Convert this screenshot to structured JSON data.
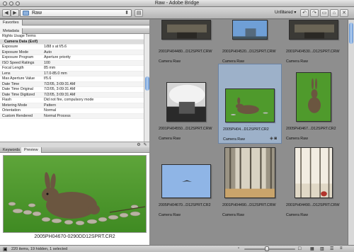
{
  "window": {
    "title": "Raw - Adobe Bridge"
  },
  "toolbar": {
    "back_glyph": "◀",
    "forward_glyph": "▶",
    "path": "Raw",
    "sort": "Unfiltered ▾"
  },
  "left_tabs": {
    "favorites": "Favorites"
  },
  "metadata": {
    "tab": "Metadata",
    "rows": [
      {
        "key": "Rights Usage Terms",
        "value": ""
      },
      {
        "key": "Camera Data (Exif)",
        "value": "",
        "section": true
      },
      {
        "key": "Exposure",
        "value": "1/88 s at f/5.6"
      },
      {
        "key": "Exposure Mode",
        "value": "Auto"
      },
      {
        "key": "Exposure Program",
        "value": "Aperture priority"
      },
      {
        "key": "ISO Speed Ratings",
        "value": "100"
      },
      {
        "key": "Focal Length",
        "value": "85 mm"
      },
      {
        "key": "Lens",
        "value": "17.0-85.0 mm"
      },
      {
        "key": "Max Aperture Value",
        "value": "f/5.6"
      },
      {
        "key": "Date Time",
        "value": "7/2/05, 3:09:31 AM"
      },
      {
        "key": "Date Time Original",
        "value": "7/2/05, 3:09:31 AM"
      },
      {
        "key": "Date Time Digitized",
        "value": "7/2/05, 3:09:31 AM"
      },
      {
        "key": "Flash",
        "value": "Did not fire, compulsory mode"
      },
      {
        "key": "Metering Mode",
        "value": "Pattern"
      },
      {
        "key": "Orientation",
        "value": "Normal"
      },
      {
        "key": "Custom Rendered",
        "value": "Normal Process"
      }
    ]
  },
  "preview_tabs": {
    "keywords": "Keywords",
    "preview": "Preview"
  },
  "preview": {
    "caption": "2005PH04670-0290DD12SPRT.CR2"
  },
  "grid": {
    "cells": [
      {
        "name": "2001PH04480...D12SPRT.CRW",
        "label": "Camera Raw",
        "tone": "dark"
      },
      {
        "name": "2001PH04520...D12SPRT.CRW",
        "label": "Camera Raw",
        "tone": "bluesky"
      },
      {
        "name": "2001PH04530...D12SPRT.CRW",
        "label": "Camera Raw",
        "tone": "dark"
      },
      {
        "name": "2001PH04550...D12SPRT.CRW",
        "label": "Camera Raw",
        "tone": "cloud"
      },
      {
        "name": "2005PH04...D12SPRT.CR2",
        "label": "Camera Raw",
        "tone": "rabbit",
        "selected": true,
        "stars": "· · · · ·"
      },
      {
        "name": "2005PH0467...D12SPRT.CR2",
        "label": "Camera Raw",
        "tone": "rabbit2"
      },
      {
        "name": "2005PH04670...D12SPRT.CR2",
        "label": "Camera Raw",
        "tone": "bird"
      },
      {
        "name": "2001PH04490...D12SPRT.CRW",
        "label": "Camera Raw",
        "tone": "hall"
      },
      {
        "name": "2001PH04490...D12SPRT.CRW",
        "label": "Camera Raw",
        "tone": "hall2"
      }
    ]
  },
  "status": {
    "text": "220 items, 19 hidden, 1 selected"
  },
  "thumbnail_size": 0.45
}
